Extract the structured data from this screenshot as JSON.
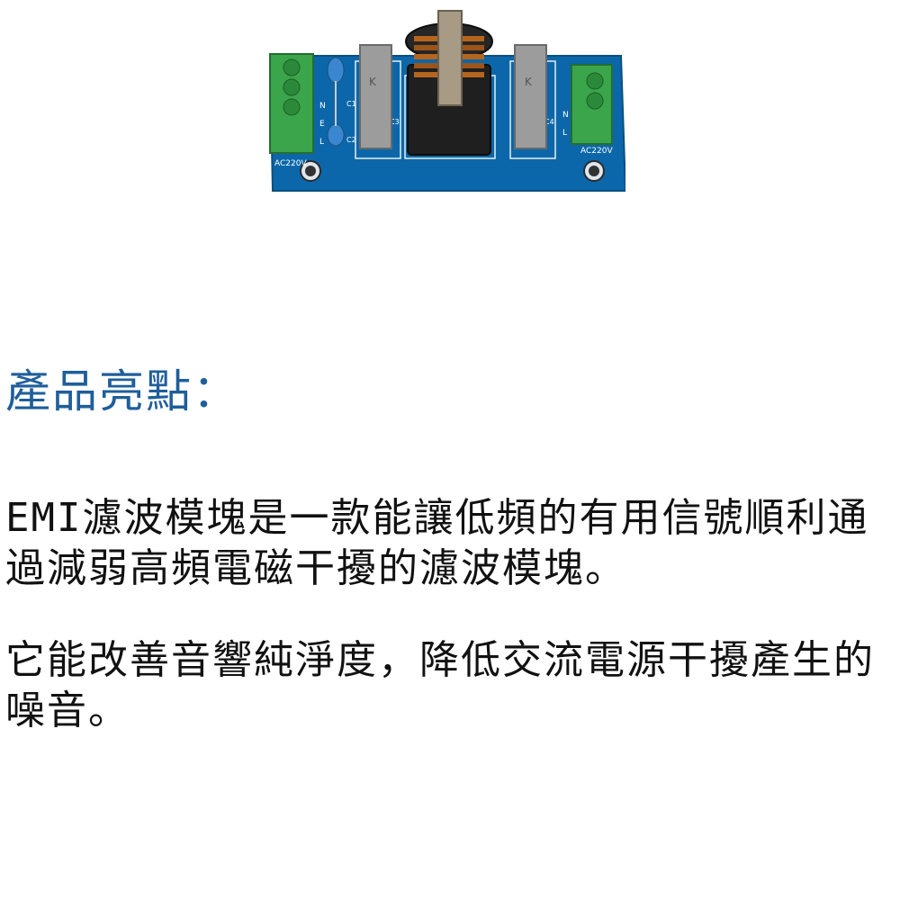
{
  "board": {
    "label_left_terminal": "AC220V",
    "label_right_terminal": "AC220V",
    "silk_c1": "C1",
    "silk_c2": "C2",
    "silk_c3": "C3",
    "silk_c4": "C4",
    "silk_l_left": "L",
    "silk_e_left": "E",
    "silk_n_left": "N",
    "silk_l_right": "L",
    "silk_n_right": "N",
    "cap_mark_k1": "K",
    "cap_mark_k2": "K",
    "colors": {
      "pcb": "#0a66a8",
      "terminal": "#3aa54a",
      "capacitor": "#9a9a9a",
      "choke_core": "#202020",
      "copper": "#b5651d"
    }
  },
  "highlights": {
    "title": "產品亮點：",
    "paragraph_1": "EMI濾波模塊是一款能讓低頻的有用信號順利通過減弱高頻電磁干擾的濾波模塊。",
    "paragraph_2": "它能改善音響純淨度，降低交流電源干擾產生的噪音。",
    "title_color": "#1f5e9a"
  }
}
